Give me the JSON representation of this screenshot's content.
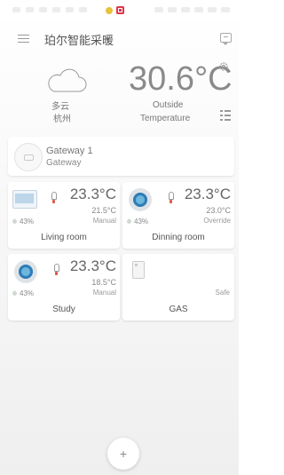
{
  "header": {
    "title": "珀尔智能采暖",
    "chevron": "⌄"
  },
  "weather": {
    "temperature": "30.6°C",
    "condition": "多云",
    "city": "杭州",
    "outside_label_1": "Outside",
    "outside_label_2": "Temperature"
  },
  "gateway": {
    "name": "Gateway 1",
    "subtitle": "Gateway"
  },
  "rooms": [
    {
      "name": "Living room",
      "temp": "23.3°C",
      "setpoint": "21.5°C",
      "mode": "Manual",
      "humidity": "43%"
    },
    {
      "name": "Dinning room",
      "temp": "23.3°C",
      "setpoint": "23.0°C",
      "mode": "Override",
      "humidity": "43%"
    },
    {
      "name": "Study",
      "temp": "23.3°C",
      "setpoint": "18.5°C",
      "mode": "Manual",
      "humidity": "43%"
    },
    {
      "name": "GAS",
      "status": "Safe"
    }
  ],
  "add_button": {
    "label": "+"
  },
  "colors": {
    "accent_red": "#e2574c",
    "thermostat_blue": "#2f7db7",
    "text_gray": "#666666"
  },
  "icons": [
    "menu-icon",
    "chevron-down-icon",
    "chat-icon",
    "cloud-icon",
    "gear-icon",
    "list-icon",
    "gateway-icon",
    "thermostat-icon",
    "flame-icon",
    "humidity-icon",
    "gas-sensor-icon",
    "add-icon"
  ]
}
